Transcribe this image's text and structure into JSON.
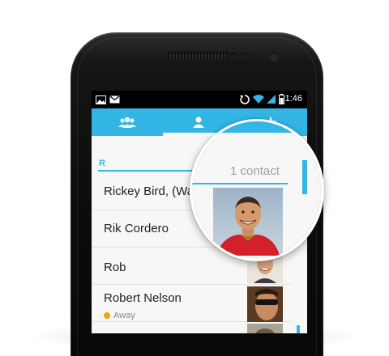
{
  "status_bar": {
    "time": "1:46",
    "left_icons": [
      "picture-icon",
      "gmail-icon"
    ],
    "right_icons": [
      "sync-icon",
      "wifi-icon",
      "signal-icon",
      "battery-icon"
    ]
  },
  "tabs": [
    {
      "icon": "groups-icon",
      "active": false
    },
    {
      "icon": "all-contacts-icon",
      "active": true
    },
    {
      "icon": "favorites-star-icon",
      "active": false
    }
  ],
  "section": {
    "letter": "R",
    "count": "1 contact"
  },
  "contacts": [
    {
      "name": "Rickey Bird, (Wa",
      "status": "",
      "photo": "man-red-shirt-photo"
    },
    {
      "name": "Rik Cordero",
      "status": "",
      "photo": ""
    },
    {
      "name": "Rob",
      "status": "",
      "photo": "smiling-man-photo"
    },
    {
      "name": "Robert Nelson",
      "status": "Away",
      "photo": "man-sunglasses-photo"
    }
  ],
  "colors": {
    "accent": "#33b5e5",
    "away": "#f0a30a"
  }
}
